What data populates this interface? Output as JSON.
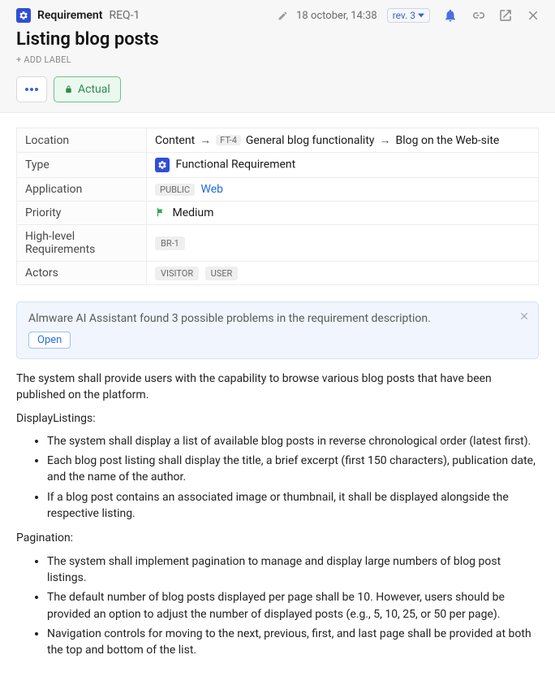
{
  "header": {
    "label": "Requirement",
    "id": "REQ-1",
    "timestamp": "18 october, 14:38",
    "revision": "rev. 3",
    "title": "Listing blog posts",
    "add_label": "+ ADD LABEL",
    "actual_btn": "Actual"
  },
  "props": {
    "location_key": "Location",
    "location_crumb1": "Content",
    "location_ft": "FT-4",
    "location_crumb2": "General blog functionality",
    "location_crumb3": "Blog on the Web-site",
    "type_key": "Type",
    "type_val": "Functional Requirement",
    "app_key": "Application",
    "app_public": "PUBLIC",
    "app_val": "Web",
    "priority_key": "Priority",
    "priority_val": "Medium",
    "hlr_key": "High-level Requirements",
    "hlr_val": "BR-1",
    "actors_key": "Actors",
    "actor1": "VISITOR",
    "actor2": "USER"
  },
  "ai": {
    "message": "Almware AI Assistant found 3 possible problems in the requirement description.",
    "open": "Open"
  },
  "body": {
    "intro": "The system shall provide users with the capability to browse various blog posts that have been published on the platform.",
    "sec1_title": "DisplayListings:",
    "sec1_items": [
      "The system shall display a list of available blog posts in reverse chronological order (latest first).",
      "Each blog post listing shall display the title, a brief excerpt (first 150 characters), publication date, and the name of the author.",
      "If a blog post contains an associated image or thumbnail, it shall be displayed alongside the respective listing."
    ],
    "sec2_title": "Pagination:",
    "sec2_items": [
      "The system shall implement pagination to manage and display large numbers of blog post listings.",
      "The default number of blog posts displayed per page shall be 10. However, users should be provided an option to adjust the number of displayed posts (e.g., 5, 10, 25, or 50 per page).",
      "Navigation controls for moving to the next, previous, first, and last page shall be provided at both the top and bottom of the list."
    ]
  }
}
